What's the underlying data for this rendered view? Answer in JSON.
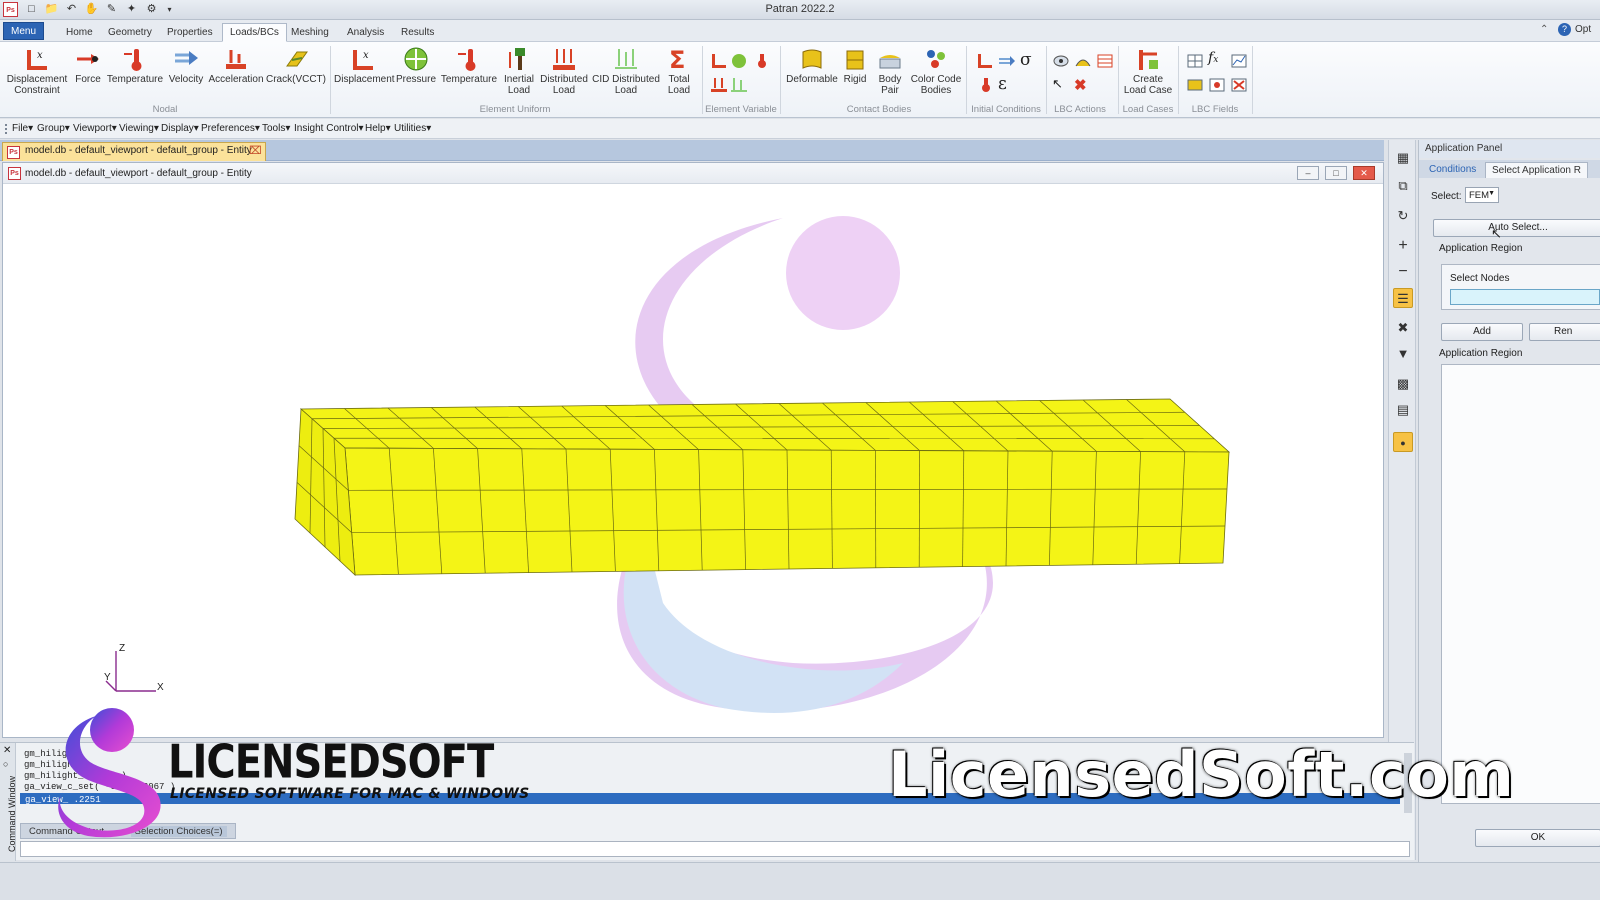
{
  "app": {
    "title": "Patran 2022.2",
    "help_label": "Opt"
  },
  "ribbon_tabs": [
    "Menu",
    "Home",
    "Geometry",
    "Properties",
    "Loads/BCs",
    "Meshing",
    "Analysis",
    "Results"
  ],
  "ribbon_active_tab": "Loads/BCs",
  "ribbon": {
    "nodal": {
      "label": "Nodal",
      "buttons": [
        "Displacement Constraint",
        "Force",
        "Temperature",
        "Velocity",
        "Acceleration",
        "Crack(VCCT)"
      ]
    },
    "element_uniform": {
      "label": "Element Uniform",
      "buttons": [
        "Displacement",
        "Pressure",
        "Temperature",
        "Inertial Load",
        "Distributed Load",
        "CID Distributed Load",
        "Total Load"
      ]
    },
    "element_variable": {
      "label": "Element Variable"
    },
    "contact_bodies": {
      "label": "Contact Bodies",
      "buttons": [
        "Deformable",
        "Rigid",
        "Body Pair",
        "Color Code Bodies"
      ]
    },
    "initial_conditions": {
      "label": "Initial Conditions"
    },
    "lbc_actions": {
      "label": "LBC Actions"
    },
    "load_cases": {
      "label": "Load Cases",
      "buttons": [
        "Create Load Case"
      ]
    },
    "lbc_fields": {
      "label": "LBC Fields"
    }
  },
  "menubar": [
    "File",
    "Group",
    "Viewport",
    "Viewing",
    "Display",
    "Preferences",
    "Tools",
    "Insight Control",
    "Help",
    "Utilities"
  ],
  "doc_tab": {
    "label": "model.db - default_viewport - default_group - Entity"
  },
  "viewport": {
    "title": "model.db - default_viewport - default_group - Entity",
    "mesh_color": "#f4f416"
  },
  "axes": {
    "z": "Z",
    "y": "Y",
    "x": "X"
  },
  "app_panel": {
    "header": "Application Panel",
    "tabs": [
      "Conditions",
      "Select Application R"
    ],
    "select_label": "Select:",
    "select_value": "FEM",
    "auto_select": "Auto Select...",
    "app_region_label": "Application Region",
    "select_nodes_label": "Select Nodes",
    "add_button": "Add",
    "remove_button": "Ren",
    "app_region_list_label": "Application Region",
    "ok_button": "OK"
  },
  "command": {
    "side_label": "Command Window",
    "lines": [
      "gm_hilight",
      "gm_hilight_d",
      "gm_hilight_clear( )",
      "ga_view_c_set( -0.         0.12067 )"
    ],
    "selected_line": "ga_view_         .2251",
    "tab_label": "Command Output",
    "tab2_label": "Selection Choices(=)"
  },
  "watermark": {
    "big": "LicensedSoft.com",
    "brand": "LICENSEDSOFT",
    "tagline": "LICENSED SOFTWARE FOR MAC & WINDOWS"
  }
}
